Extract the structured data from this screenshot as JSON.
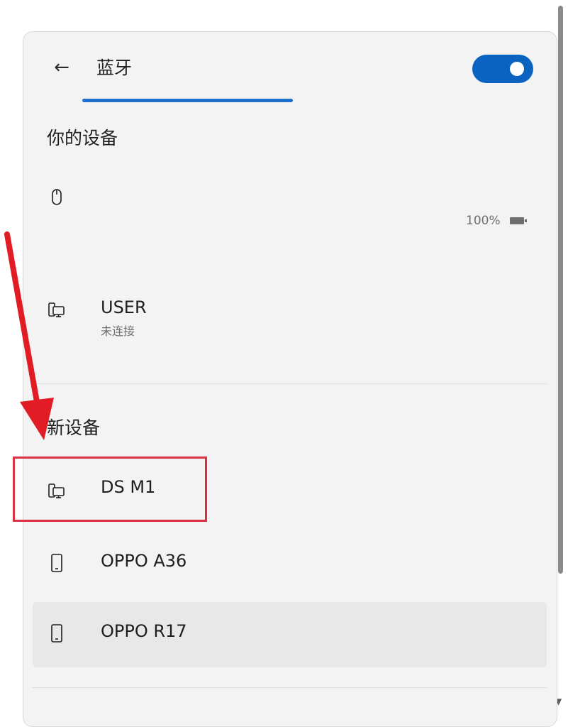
{
  "header": {
    "back_label": "←",
    "title": "蓝牙",
    "bluetooth_on": true
  },
  "your_devices": {
    "heading": "你的设备",
    "devices": [
      {
        "name": "",
        "icon": "mouse-icon",
        "battery": "100%",
        "status": ""
      },
      {
        "name": "USER",
        "icon": "pc-monitor-icon",
        "status": "未连接"
      }
    ]
  },
  "new_devices": {
    "heading": "新设备",
    "devices": [
      {
        "name": "DS M1",
        "icon": "pc-monitor-icon"
      },
      {
        "name": "OPPO A36",
        "icon": "phone-icon"
      },
      {
        "name": "OPPO R17",
        "icon": "phone-icon"
      }
    ]
  },
  "colors": {
    "accent": "#0b63c1",
    "annotation": "#d9313f",
    "panel": "#f3f3f3"
  }
}
